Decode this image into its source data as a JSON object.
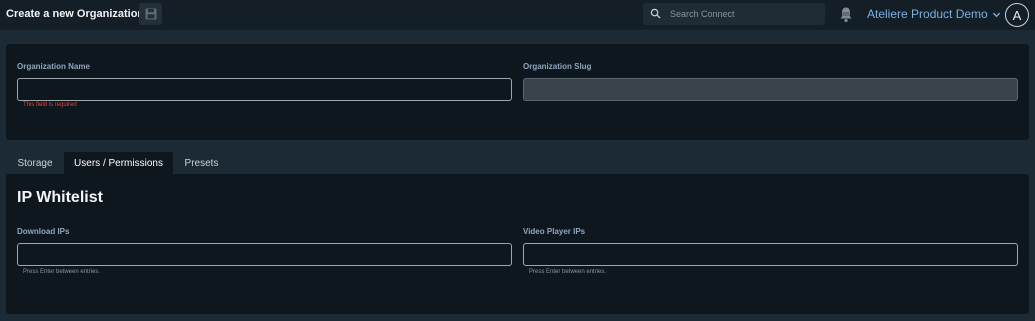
{
  "header": {
    "title": "Create a new Organization",
    "search_placeholder": "Search Connect",
    "org_name": "Ateliere Product Demo",
    "avatar_initial": "A"
  },
  "organization": {
    "name_label": "Organization Name",
    "name_value": "",
    "name_error": "This field is required",
    "slug_label": "Organization Slug",
    "slug_value": ""
  },
  "tabs": [
    {
      "label": "Storage",
      "active": false
    },
    {
      "label": "Users / Permissions",
      "active": true
    },
    {
      "label": "Presets",
      "active": false
    }
  ],
  "whitelist": {
    "heading": "IP Whitelist",
    "download_label": "Download IPs",
    "download_hint": "Press Enter between entries.",
    "player_label": "Video Player IPs",
    "player_hint": "Press Enter between entries."
  },
  "colors": {
    "background": "#1b2a34",
    "card": "#0f171e",
    "accent": "#7eaee0",
    "error": "#e0483c"
  },
  "icons": {
    "save": "floppy-disk-icon",
    "search": "magnifier-icon",
    "notifications": "bell-icon",
    "org_dropdown": "chevron-down-icon"
  }
}
